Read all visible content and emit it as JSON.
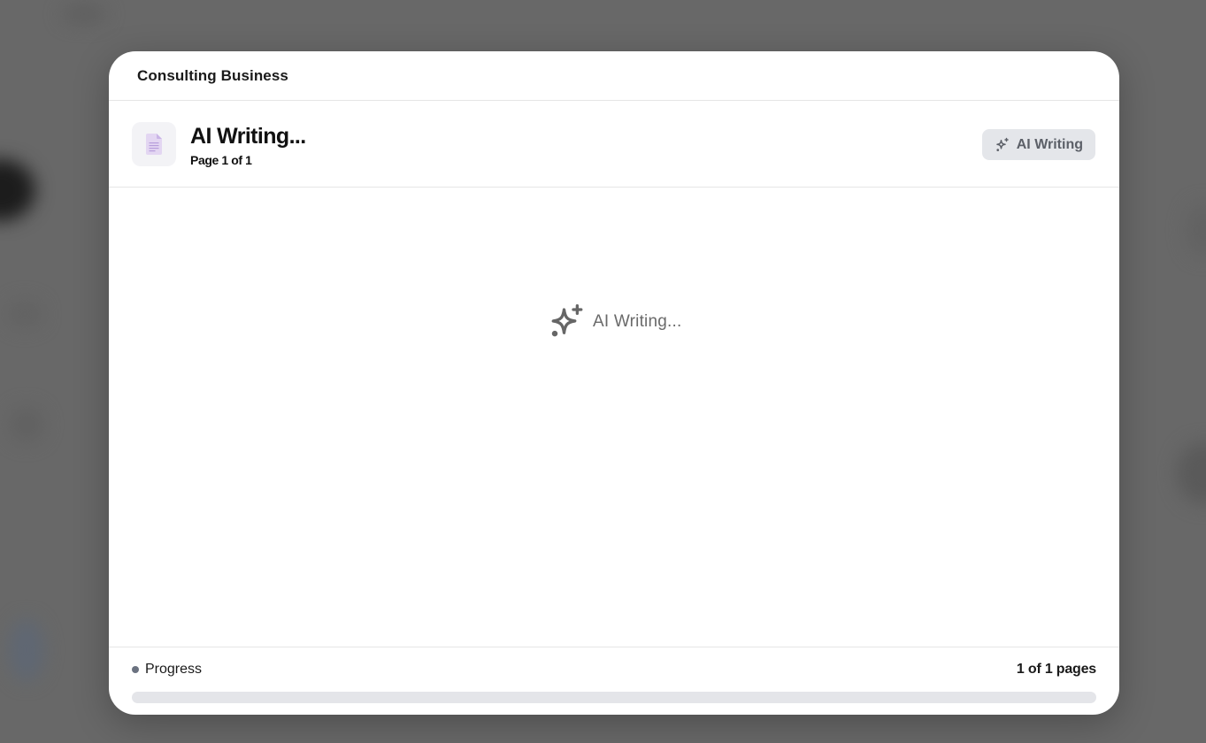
{
  "modal": {
    "title": "Consulting Business"
  },
  "document": {
    "title": "AI Writing...",
    "subtitle": "Page 1 of 1",
    "icon": "document-icon",
    "ai_button_label": "AI Writing",
    "ai_button_icon": "sparkles-icon"
  },
  "content": {
    "status_text": "AI Writing...",
    "status_icon": "sparkles-icon"
  },
  "footer": {
    "progress_label": "Progress",
    "pages_count": "1 of 1 pages",
    "progress_fraction": 0
  },
  "colors": {
    "overlay": "#686868",
    "button_bg": "#e4e6ea",
    "progress_track": "#e4e5e9",
    "dot": "#6b7280",
    "doc_icon": "#d8c8ec"
  }
}
